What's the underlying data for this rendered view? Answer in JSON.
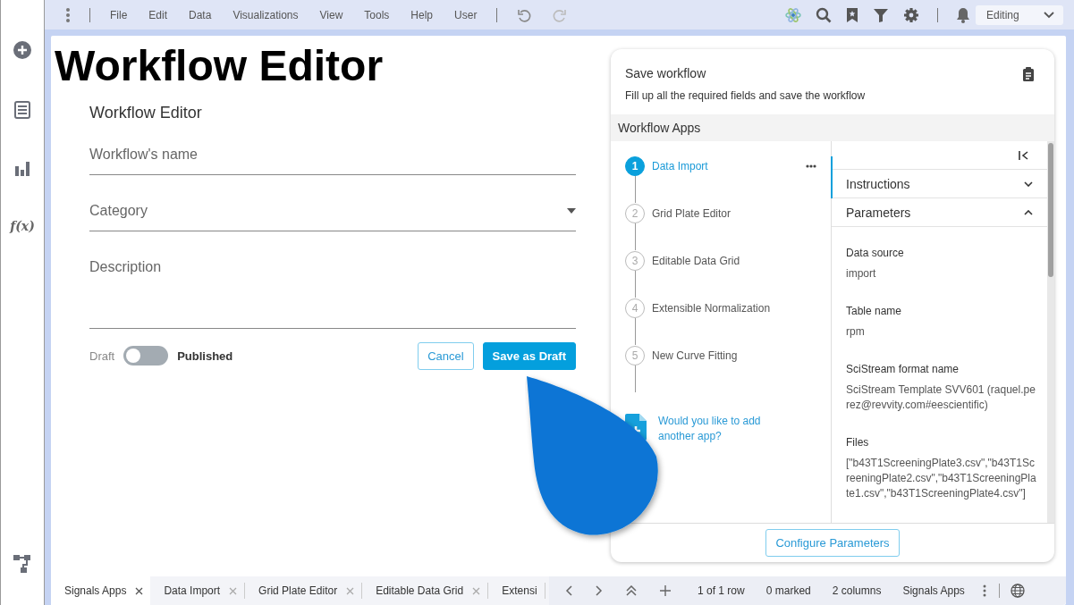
{
  "sidebar": {
    "function_label": "f(x)"
  },
  "menu_bar": {
    "items": [
      "File",
      "Edit",
      "Data",
      "Visualizations",
      "View",
      "Tools",
      "Help",
      "User"
    ],
    "mode": "Editing"
  },
  "page_title": "Workflow Editor",
  "form": {
    "title": "Workflow Editor",
    "fields": [
      {
        "kind": "text",
        "placeholder": "Workflow's name"
      },
      {
        "kind": "select",
        "placeholder": "Category"
      },
      {
        "kind": "textarea",
        "placeholder": "Description"
      }
    ],
    "status_toggle": {
      "off_label": "Draft",
      "on_label": "Published",
      "on": false
    },
    "buttons": [
      {
        "kind": "outline",
        "label": "Cancel"
      },
      {
        "kind": "primary",
        "label": "Save as Draft"
      }
    ]
  },
  "save_panel": {
    "title": "Save workflow",
    "subtitle": "Fill up all the required fields and save the workflow",
    "section_title": "Workflow Apps",
    "apps": [
      {
        "number": "1",
        "name": "Data Import",
        "selected": true
      },
      {
        "number": "2",
        "name": "Grid Plate Editor",
        "selected": false
      },
      {
        "number": "3",
        "name": "Editable Data Grid",
        "selected": false
      },
      {
        "number": "4",
        "name": "Extensible Normalization",
        "selected": false
      },
      {
        "number": "5",
        "name": "New Curve Fitting",
        "selected": false
      }
    ],
    "add_app_prompt": "Would you like to add another app?",
    "sections": [
      {
        "title": "Instructions",
        "expanded": false
      },
      {
        "title": "Parameters",
        "expanded": true
      }
    ],
    "parameters": [
      {
        "name": "Data source",
        "value": "import"
      },
      {
        "name": "Table name",
        "value": "rpm"
      },
      {
        "name": "SciStream format name",
        "value": "SciStream Template SVV601 (raquel.perez@revvity.com#eescientific)"
      },
      {
        "name": "Files",
        "value": "[\"b43T1ScreeningPlate3.csv\",\"b43T1ScreeningPlate2.csv\",\"b43T1ScreeningPlate1.csv\",\"b43T1ScreeningPlate4.csv\"]"
      }
    ],
    "configure_button": "Configure Parameters"
  },
  "bottom_bar": {
    "tabs": [
      {
        "label": "Signals Apps",
        "selected": true,
        "closable": true
      },
      {
        "label": "Data Import",
        "selected": false,
        "closable": true
      },
      {
        "label": "Grid Plate Editor",
        "selected": false,
        "closable": true
      },
      {
        "label": "Editable Data Grid",
        "selected": false,
        "closable": true
      },
      {
        "label": "Extensi",
        "selected": false,
        "closable": false
      }
    ],
    "status": [
      "1 of 1 row",
      "0 marked",
      "2 columns",
      "Signals Apps"
    ]
  }
}
